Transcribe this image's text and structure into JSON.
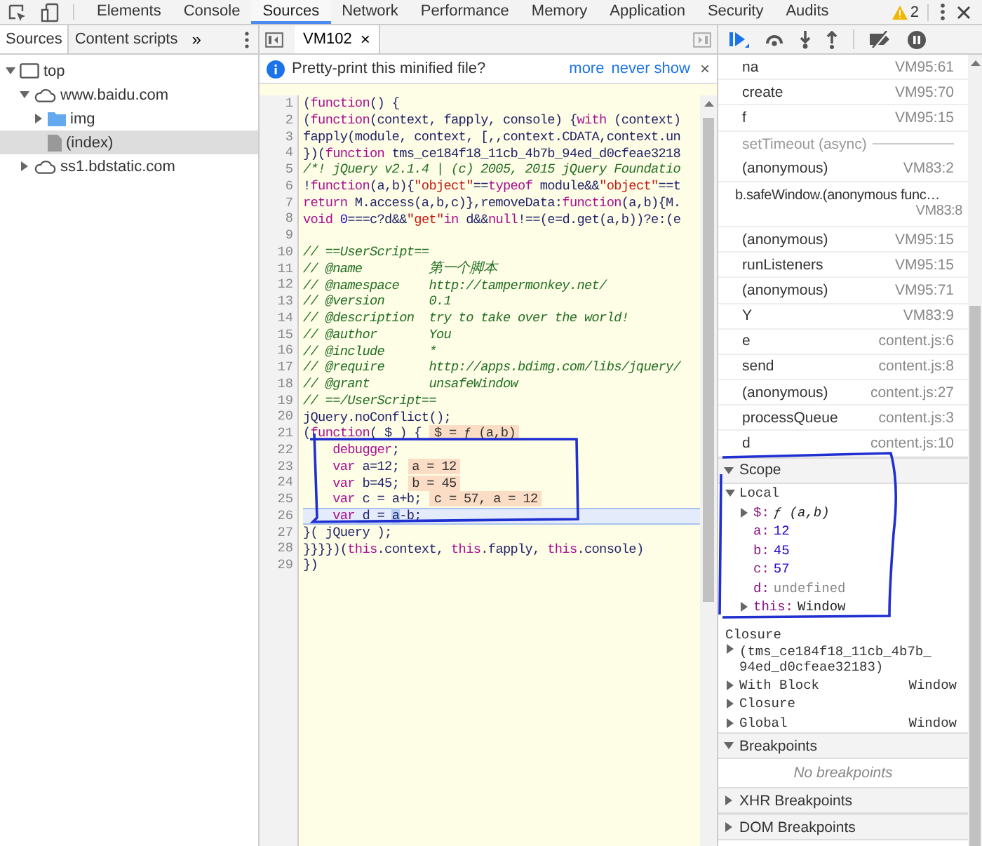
{
  "toolbar": {
    "tabs": [
      {
        "label": "Elements",
        "selected": false
      },
      {
        "label": "Console",
        "selected": false
      },
      {
        "label": "Sources",
        "selected": true
      },
      {
        "label": "Network",
        "selected": false
      },
      {
        "label": "Performance",
        "selected": false
      },
      {
        "label": "Memory",
        "selected": false
      },
      {
        "label": "Application",
        "selected": false
      },
      {
        "label": "Security",
        "selected": false
      },
      {
        "label": "Audits",
        "selected": false
      }
    ],
    "warning_count": "2"
  },
  "navigator": {
    "tabs": [
      {
        "label": "Sources",
        "selected": true
      },
      {
        "label": "Content scripts",
        "selected": false
      }
    ],
    "more": "»",
    "tree": [
      {
        "label": "top",
        "kind": "frame",
        "expanded": true,
        "selected": false,
        "children": [
          {
            "label": "www.baidu.com",
            "kind": "domain",
            "expanded": true,
            "selected": false,
            "children": [
              {
                "label": "img",
                "kind": "folder",
                "expanded": false,
                "selected": false
              },
              {
                "label": "(index)",
                "kind": "file",
                "selected": true
              }
            ]
          },
          {
            "label": "ss1.bdstatic.com",
            "kind": "domain",
            "expanded": false,
            "selected": false
          }
        ]
      }
    ]
  },
  "editor": {
    "tabs": [
      {
        "label": "VM102",
        "selected": true,
        "close": "×"
      }
    ],
    "infobar": {
      "message": "Pretty-print this minified file?",
      "links": [
        "more",
        "never show"
      ],
      "close": "×"
    },
    "lines": [
      {
        "number": "1",
        "current": false,
        "tokens": [
          {
            "kind": "plain",
            "text": "("
          },
          {
            "kind": "keyword",
            "text": "function"
          },
          {
            "kind": "plain",
            "text": "() {"
          }
        ]
      },
      {
        "number": "2",
        "current": false,
        "tokens": [
          {
            "kind": "plain",
            "text": "("
          },
          {
            "kind": "keyword",
            "text": "function"
          },
          {
            "kind": "plain",
            "text": "(context, fapply, console) {"
          },
          {
            "kind": "keyword",
            "text": "with"
          },
          {
            "kind": "plain",
            "text": " (context)"
          }
        ]
      },
      {
        "number": "3",
        "current": false,
        "tokens": [
          {
            "kind": "plain",
            "text": "fapply(module, context, [,,context.CDATA,context.un"
          }
        ]
      },
      {
        "number": "4",
        "current": false,
        "tokens": [
          {
            "kind": "plain",
            "text": "})("
          },
          {
            "kind": "keyword",
            "text": "function"
          },
          {
            "kind": "plain",
            "text": " tms_ce184f18_11cb_4b7b_94ed_d0cfeae3218"
          }
        ]
      },
      {
        "number": "5",
        "current": false,
        "tokens": [
          {
            "kind": "comment",
            "text": "/*! jQuery v2.1.4 | (c) 2005, 2015 jQuery Foundatio"
          }
        ]
      },
      {
        "number": "6",
        "current": false,
        "tokens": [
          {
            "kind": "plain",
            "text": "!"
          },
          {
            "kind": "keyword",
            "text": "function"
          },
          {
            "kind": "plain",
            "text": "(a,b){"
          },
          {
            "kind": "string",
            "text": "\"object\""
          },
          {
            "kind": "plain",
            "text": "=="
          },
          {
            "kind": "keyword",
            "text": "typeof"
          },
          {
            "kind": "plain",
            "text": " module&&"
          },
          {
            "kind": "string",
            "text": "\"object\""
          },
          {
            "kind": "plain",
            "text": "==t"
          }
        ]
      },
      {
        "number": "7",
        "current": false,
        "tokens": [
          {
            "kind": "keyword",
            "text": "return"
          },
          {
            "kind": "plain",
            "text": " M.access(a,b,c)},removeData:"
          },
          {
            "kind": "keyword",
            "text": "function"
          },
          {
            "kind": "plain",
            "text": "(a,b){M."
          }
        ]
      },
      {
        "number": "8",
        "current": false,
        "tokens": [
          {
            "kind": "keyword",
            "text": "void"
          },
          {
            "kind": "number",
            "text": " 0"
          },
          {
            "kind": "plain",
            "text": "===c?d&&"
          },
          {
            "kind": "string",
            "text": "\"get\""
          },
          {
            "kind": "keyword",
            "text": "in"
          },
          {
            "kind": "plain",
            "text": " d&&"
          },
          {
            "kind": "keyword",
            "text": "null"
          },
          {
            "kind": "plain",
            "text": "!==(e=d.get(a,b))?e:(e"
          }
        ]
      },
      {
        "number": "9",
        "current": false
      },
      {
        "number": "10",
        "current": false,
        "tokens": [
          {
            "kind": "comment",
            "text": "// ==UserScript=="
          }
        ]
      },
      {
        "number": "11",
        "current": false,
        "tokens": [
          {
            "kind": "comment",
            "text": "// @name         "
          },
          {
            "kind": "comment_cjk",
            "text": "第一个脚本"
          }
        ]
      },
      {
        "number": "12",
        "current": false,
        "tokens": [
          {
            "kind": "comment",
            "text": "// @namespace    http://tampermonkey.net/"
          }
        ]
      },
      {
        "number": "13",
        "current": false,
        "tokens": [
          {
            "kind": "comment",
            "text": "// @version      0.1"
          }
        ]
      },
      {
        "number": "14",
        "current": false,
        "tokens": [
          {
            "kind": "comment",
            "text": "// @description  try to take over the world!"
          }
        ]
      },
      {
        "number": "15",
        "current": false,
        "tokens": [
          {
            "kind": "comment",
            "text": "// @author       You"
          }
        ]
      },
      {
        "number": "16",
        "current": false,
        "tokens": [
          {
            "kind": "comment",
            "text": "// @include      *"
          }
        ]
      },
      {
        "number": "17",
        "current": false,
        "tokens": [
          {
            "kind": "comment",
            "text": "// @require      http://apps.bdimg.com/libs/jquery/"
          }
        ]
      },
      {
        "number": "18",
        "current": false,
        "tokens": [
          {
            "kind": "comment",
            "text": "// @grant        unsafeWindow"
          }
        ]
      },
      {
        "number": "19",
        "current": false,
        "tokens": [
          {
            "kind": "comment",
            "text": "// ==/UserScript=="
          }
        ]
      },
      {
        "number": "20",
        "current": false,
        "tokens": [
          {
            "kind": "plain",
            "text": "jQuery.noConflict();"
          }
        ]
      },
      {
        "number": "21",
        "current": false,
        "tokens": [
          {
            "kind": "plain",
            "text": "("
          },
          {
            "kind": "keyword",
            "text": "function"
          },
          {
            "kind": "plain",
            "text": "( $ ) {"
          }
        ],
        "inline_value": "$ = ƒ (a,b)"
      },
      {
        "number": "22",
        "current": false,
        "tokens": [
          {
            "kind": "keyword",
            "text": "    debugger"
          },
          {
            "kind": "plain",
            "text": ";"
          }
        ]
      },
      {
        "number": "23",
        "current": false,
        "tokens": [
          {
            "kind": "keyword",
            "text": "    var"
          },
          {
            "kind": "plain",
            "text": " a=12;"
          }
        ],
        "inline_value": "a = 12"
      },
      {
        "number": "24",
        "current": false,
        "tokens": [
          {
            "kind": "keyword",
            "text": "    var"
          },
          {
            "kind": "plain",
            "text": " b=45;"
          }
        ],
        "inline_value": "b = 45"
      },
      {
        "number": "25",
        "current": false,
        "tokens": [
          {
            "kind": "keyword",
            "text": "    var"
          },
          {
            "kind": "plain",
            "text": " c = a+b;"
          }
        ],
        "inline_value": "c = 57, a = 12"
      },
      {
        "number": "26",
        "current": true,
        "tokens": [
          {
            "kind": "keyword",
            "text": "    var"
          },
          {
            "kind": "plain",
            "text": " d = "
          },
          {
            "kind": "match",
            "text": "a"
          },
          {
            "kind": "plain",
            "text": "-b;"
          }
        ]
      },
      {
        "number": "27",
        "current": false,
        "tokens": [
          {
            "kind": "plain",
            "text": "}( jQuery );"
          }
        ]
      },
      {
        "number": "28",
        "current": false,
        "tokens": [
          {
            "kind": "plain",
            "text": "}}}})("
          },
          {
            "kind": "keyword",
            "text": "this"
          },
          {
            "kind": "plain",
            "text": ".context, "
          },
          {
            "kind": "keyword",
            "text": "this"
          },
          {
            "kind": "plain",
            "text": ".fapply, "
          },
          {
            "kind": "keyword",
            "text": "this"
          },
          {
            "kind": "plain",
            "text": ".console)"
          }
        ]
      },
      {
        "number": "29",
        "current": false,
        "tokens": [
          {
            "kind": "plain",
            "text": "})"
          }
        ]
      }
    ]
  },
  "call_stack": [
    {
      "kind": "frame",
      "function": "na",
      "location": "VM95:61"
    },
    {
      "kind": "frame",
      "function": "create",
      "location": "VM95:70"
    },
    {
      "kind": "frame",
      "function": "f",
      "location": "VM95:15"
    },
    {
      "kind": "async",
      "label": "setTimeout (async)"
    },
    {
      "kind": "frame",
      "function": "(anonymous)",
      "location": "VM83:2"
    },
    {
      "kind": "frame",
      "function": "b.safeWindow.(anonymous func…",
      "location": "VM83:8"
    },
    {
      "kind": "frame",
      "function": "(anonymous)",
      "location": "VM95:15"
    },
    {
      "kind": "frame",
      "function": "runListeners",
      "location": "VM95:15"
    },
    {
      "kind": "frame",
      "function": "(anonymous)",
      "location": "VM95:71"
    },
    {
      "kind": "frame",
      "function": "Y",
      "location": "VM83:9"
    },
    {
      "kind": "frame",
      "function": "e",
      "location": "content.js:6"
    },
    {
      "kind": "frame",
      "function": "send",
      "location": "content.js:8"
    },
    {
      "kind": "frame",
      "function": "(anonymous)",
      "location": "content.js:27"
    },
    {
      "kind": "frame",
      "function": "processQueue",
      "location": "content.js:3"
    },
    {
      "kind": "frame",
      "function": "d",
      "location": "content.js:10"
    }
  ],
  "scope": {
    "label": "Scope",
    "expanded": true,
    "sections": [
      {
        "name": "Local",
        "expanded": true,
        "vars": [
          {
            "name": "$:",
            "value": "ƒ (a,b)",
            "kind": "function"
          },
          {
            "name": "a:",
            "value": "12",
            "kind": "number"
          },
          {
            "name": "b:",
            "value": "45",
            "kind": "number"
          },
          {
            "name": "c:",
            "value": "57",
            "kind": "number"
          },
          {
            "name": "d:",
            "value": "undefined",
            "kind": "undefined"
          },
          {
            "name": "this:",
            "value": "Window",
            "kind": "object"
          }
        ]
      },
      {
        "name": "Closure",
        "detail": "(tms_ce184f18_11cb_4b7b_94ed_d0cfeae32183)",
        "expanded": false
      },
      {
        "name": "With Block",
        "value": "Window",
        "expanded": false
      },
      {
        "name": "Closure",
        "expanded": false
      },
      {
        "name": "Global",
        "value": "Window",
        "expanded": false
      }
    ]
  },
  "panes": [
    {
      "label": "Breakpoints",
      "expanded": true,
      "empty": "No breakpoints"
    },
    {
      "label": "XHR Breakpoints",
      "expanded": false
    },
    {
      "label": "DOM Breakpoints",
      "expanded": false
    }
  ]
}
